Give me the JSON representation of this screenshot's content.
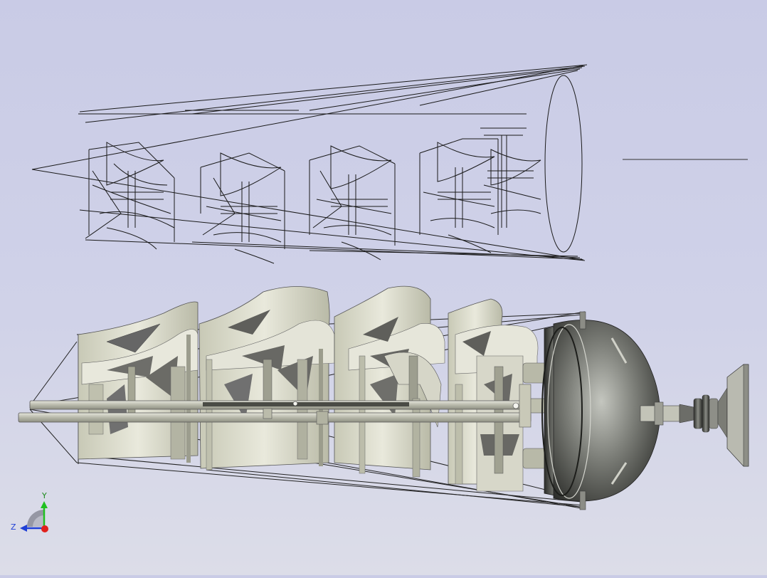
{
  "viewport": {
    "background_top": "#c9cbe6",
    "background_bottom": "#dcdde8"
  },
  "triad": {
    "x_label": "",
    "y_label": "Y",
    "z_label": "Z",
    "x_color": "#e0201c",
    "y_color": "#20c020",
    "z_color": "#1f3fd6"
  },
  "model": {
    "wire_color": "#1a1a1a",
    "blade_color": "#dcdccb",
    "hub_color": "#5a5c57"
  }
}
